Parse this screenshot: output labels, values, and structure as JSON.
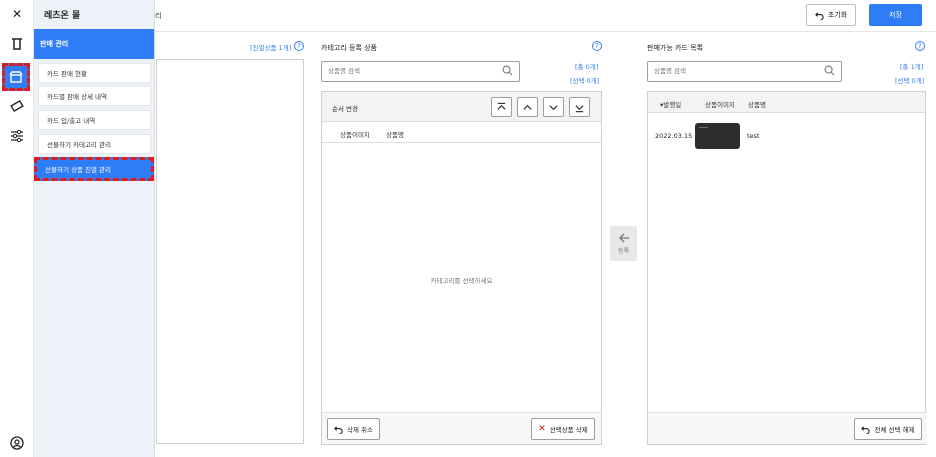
{
  "header": {
    "title_fragment": "리",
    "reset_label": "초기화",
    "save_label": "저장"
  },
  "rail": {
    "icons": [
      "close-icon",
      "trash-icon",
      "store-icon",
      "ticket-icon",
      "sliders-icon",
      "user-circle-icon"
    ]
  },
  "drawer": {
    "title": "레츠온 몰",
    "section": "판매 관리",
    "items": [
      {
        "label": "카드 판매 현황"
      },
      {
        "label": "카드별 판매 상세 내역"
      },
      {
        "label": "카드 입/출고 내역"
      },
      {
        "label": "선물하기 카테고리 관리"
      },
      {
        "label": "선물하기 상품 진열 관리"
      }
    ]
  },
  "left_panel": {
    "count_label": "[진열상품 1개]"
  },
  "middle_panel": {
    "title": "카테고리 등록 상품",
    "search_placeholder": "상품명 검색",
    "total_label": "[총 0개]",
    "selected_label": "[선택 0개]",
    "order_label": "순서 변경",
    "columns": [
      "상품이미지",
      "상품명"
    ],
    "empty_message": "카테고리를 선택하세요",
    "undo_delete_label": "삭제 취소",
    "delete_selected_label": "선택상품 삭제"
  },
  "register": {
    "label": "등록"
  },
  "right_panel": {
    "title": "판매가능 카드 목록",
    "search_placeholder": "상품명 검색",
    "total_label": "[총 1개]",
    "selected_label": "[선택 0개]",
    "columns": [
      "발행일",
      "상품이미지",
      "상품명"
    ],
    "rows": [
      {
        "date": "2022.03.15",
        "name": "test"
      }
    ],
    "clear_selection_label": "전체 선택 해제"
  },
  "colors": {
    "accent": "#2f7df6",
    "highlight_dash": "#e11c1c"
  }
}
